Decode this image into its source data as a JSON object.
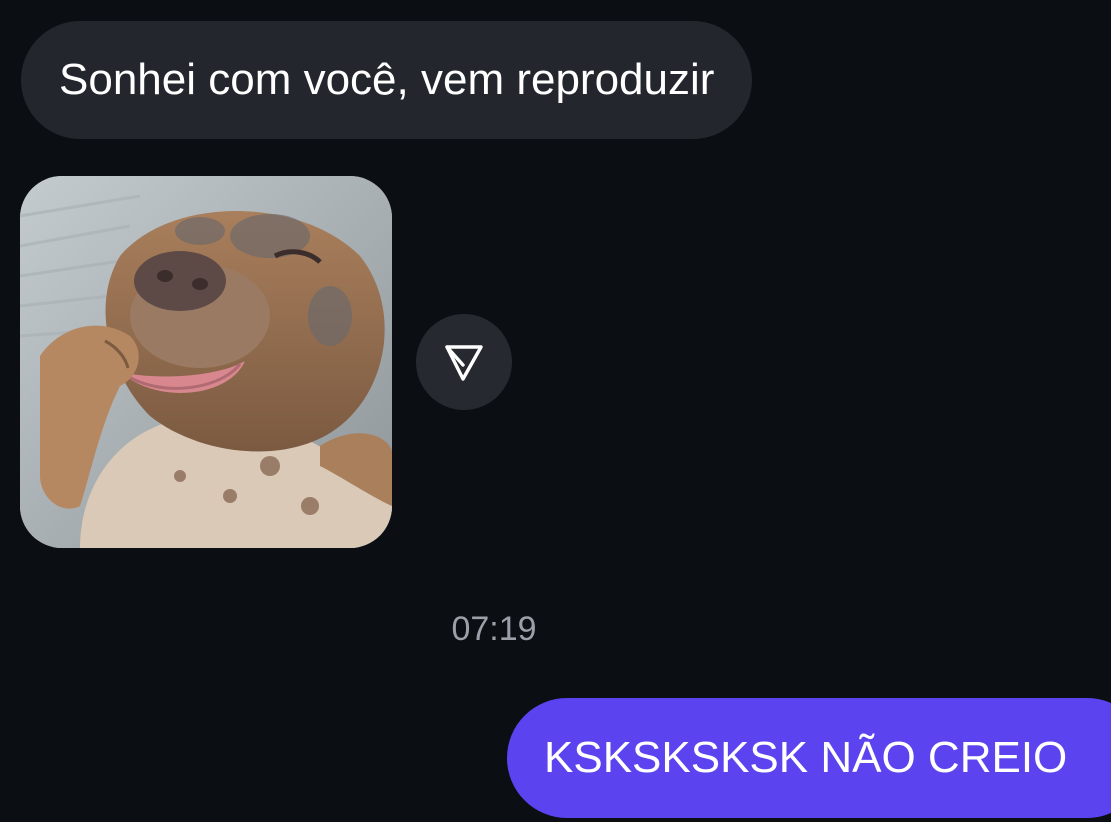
{
  "messages": {
    "incoming_text": "Sonhei com você, vem reproduzir",
    "incoming_media_icon": "dog-photo-sticker",
    "share_icon": "send-triangle-icon",
    "timestamp": "07:19",
    "outgoing_text": "KSKSKSKSK NÃO CREIO"
  },
  "colors": {
    "background": "#0b0f14",
    "incoming_bubble": "#23272d",
    "outgoing_bubble": "#5b44f0",
    "timestamp_text": "#9ba0a8"
  }
}
